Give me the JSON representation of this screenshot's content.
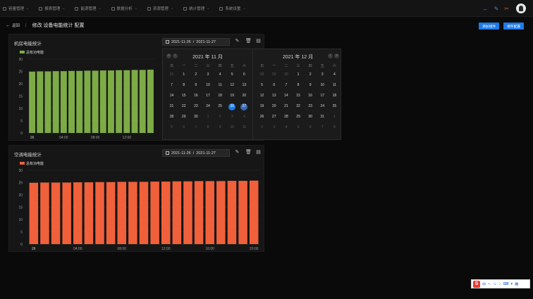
{
  "nav": [
    {
      "label": "容量管理"
    },
    {
      "label": "报表管理"
    },
    {
      "label": "能源管理"
    },
    {
      "label": "数据分析"
    },
    {
      "label": "资源管理"
    },
    {
      "label": "统计管理"
    },
    {
      "label": "系统设置"
    }
  ],
  "header": {
    "back_label": "返回",
    "title": "修改 设备电能统计 配置"
  },
  "buttons": {
    "add": "添加组件",
    "save": "保存配置"
  },
  "panel1": {
    "title": "机房电能统计",
    "date_start": "2021-11-26",
    "date_sep": "/",
    "date_end": "2021-11-27"
  },
  "panel2": {
    "title": "空调电能统计",
    "date_start": "2021-11-26",
    "date_sep": "/",
    "date_end": "2021-11-27"
  },
  "calendar": {
    "weekdays": [
      "日",
      "一",
      "二",
      "三",
      "四",
      "五",
      "六"
    ],
    "left": {
      "title": "2021 年 11 月",
      "days": [
        [
          "31",
          "1",
          "2",
          "3",
          "4",
          "5",
          "6"
        ],
        [
          "7",
          "8",
          "9",
          "10",
          "11",
          "12",
          "13"
        ],
        [
          "14",
          "15",
          "16",
          "17",
          "18",
          "19",
          "20"
        ],
        [
          "21",
          "22",
          "23",
          "24",
          "25",
          "26",
          "27"
        ],
        [
          "28",
          "29",
          "30",
          "1",
          "2",
          "3",
          "4"
        ],
        [
          "5",
          "6",
          "7",
          "8",
          "9",
          "10",
          "11"
        ]
      ],
      "muted": [
        [
          0,
          0
        ],
        [
          4,
          3
        ],
        [
          4,
          4
        ],
        [
          4,
          5
        ],
        [
          4,
          6
        ],
        [
          5,
          0
        ],
        [
          5,
          1
        ],
        [
          5,
          2
        ],
        [
          5,
          3
        ],
        [
          5,
          4
        ],
        [
          5,
          5
        ],
        [
          5,
          6
        ]
      ],
      "selected": [
        3,
        5
      ],
      "range_end": [
        3,
        6
      ]
    },
    "right": {
      "title": "2021 年 12 月",
      "days": [
        [
          "28",
          "29",
          "30",
          "1",
          "2",
          "3",
          "4"
        ],
        [
          "5",
          "6",
          "7",
          "8",
          "9",
          "10",
          "11"
        ],
        [
          "12",
          "13",
          "14",
          "15",
          "16",
          "17",
          "18"
        ],
        [
          "19",
          "20",
          "21",
          "22",
          "23",
          "24",
          "25"
        ],
        [
          "26",
          "27",
          "28",
          "29",
          "30",
          "31",
          "1"
        ],
        [
          "2",
          "3",
          "4",
          "5",
          "6",
          "7",
          "8"
        ]
      ],
      "muted": [
        [
          0,
          0
        ],
        [
          0,
          1
        ],
        [
          0,
          2
        ],
        [
          4,
          6
        ],
        [
          5,
          0
        ],
        [
          5,
          1
        ],
        [
          5,
          2
        ],
        [
          5,
          3
        ],
        [
          5,
          4
        ],
        [
          5,
          5
        ],
        [
          5,
          6
        ]
      ]
    }
  },
  "chart_data": [
    {
      "type": "bar",
      "title": "机房电能统计",
      "legend": "总有功电能",
      "color": "#7dab46",
      "ylim": [
        0,
        30
      ],
      "yticks": [
        0,
        5,
        10,
        15,
        20,
        25,
        30
      ],
      "x_labels": [
        "26",
        "04:00",
        "08:00",
        "12:00"
      ],
      "x_label_positions": [
        0,
        4,
        8,
        12
      ],
      "values": [
        24.9,
        25.0,
        25.0,
        25.1,
        25.1,
        25.2,
        25.2,
        25.3,
        25.3,
        25.4,
        25.4,
        25.5,
        25.5,
        25.6,
        25.6,
        25.7
      ]
    },
    {
      "type": "bar",
      "title": "空调电能统计",
      "legend": "总有功电能",
      "color": "#f0603a",
      "ylim": [
        0,
        30
      ],
      "yticks": [
        0,
        5,
        10,
        15,
        20,
        25,
        30
      ],
      "x_labels": [
        "26",
        "04:00",
        "08:00",
        "12:00",
        "16:00",
        "20:00"
      ],
      "x_label_positions": [
        0,
        4,
        8,
        12,
        16,
        20
      ],
      "values": [
        24.9,
        25.0,
        25.0,
        25.0,
        25.1,
        25.1,
        25.2,
        25.2,
        25.3,
        25.3,
        25.3,
        25.4,
        25.4,
        25.5,
        25.5,
        25.6,
        25.6,
        25.6,
        25.7,
        25.7,
        25.8
      ]
    }
  ]
}
